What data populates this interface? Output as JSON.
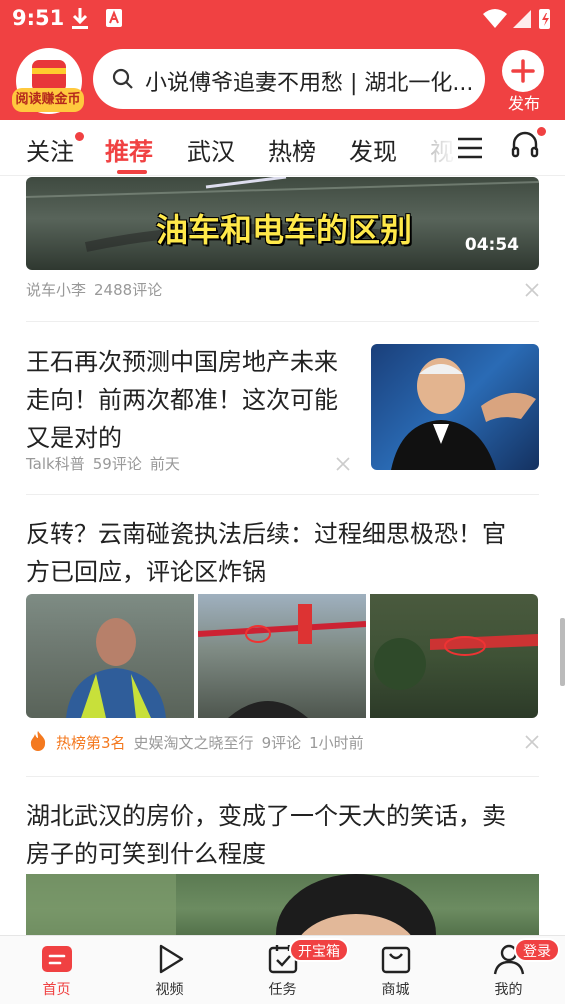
{
  "status_bar": {
    "time": "9:51"
  },
  "header": {
    "coin_label": "阅读赚金币",
    "search": {
      "text": "小说傅爷追妻不用愁 | 湖北一化..."
    },
    "publish_label": "发布"
  },
  "tabs": [
    {
      "label": "关注",
      "has_dot": true
    },
    {
      "label": "推荐",
      "active": true
    },
    {
      "label": "武汉"
    },
    {
      "label": "热榜"
    },
    {
      "label": "发现"
    },
    {
      "label": "视"
    }
  ],
  "feed": {
    "video": {
      "overlay_title": "油车和电车的区别",
      "duration": "04:54",
      "author": "说车小李",
      "comments": "2488评论"
    },
    "article1": {
      "title_lines": [
        "王石再次预测中国房地产未来",
        "走向！前两次都准！这次可能",
        "又是对的"
      ],
      "source": "Talk科普",
      "comments": "59评论",
      "time": "前天"
    },
    "article2": {
      "title_lines": [
        "反转？云南碰瓷执法后续：过程细思极恐！官",
        "方已回应，评论区炸锅"
      ],
      "hot_rank": "热榜第3名",
      "source": "史娱淘文之晓至行",
      "comments": "9评论",
      "time": "1小时前"
    },
    "article3": {
      "title_lines": [
        "湖北武汉的房价，变成了一个天大的笑话，卖",
        "房子的可笑到什么程度"
      ]
    }
  },
  "bottom_nav": [
    {
      "label": "首页",
      "icon": "home-icon",
      "active": true
    },
    {
      "label": "视频",
      "icon": "video-play-icon"
    },
    {
      "label": "任务",
      "icon": "task-icon",
      "badge": "开宝箱"
    },
    {
      "label": "商城",
      "icon": "shop-bag-icon"
    },
    {
      "label": "我的",
      "icon": "profile-icon",
      "badge": "登录"
    }
  ],
  "colors": {
    "brand": "#f04142",
    "hot": "#f4791f",
    "meta": "#999999"
  }
}
